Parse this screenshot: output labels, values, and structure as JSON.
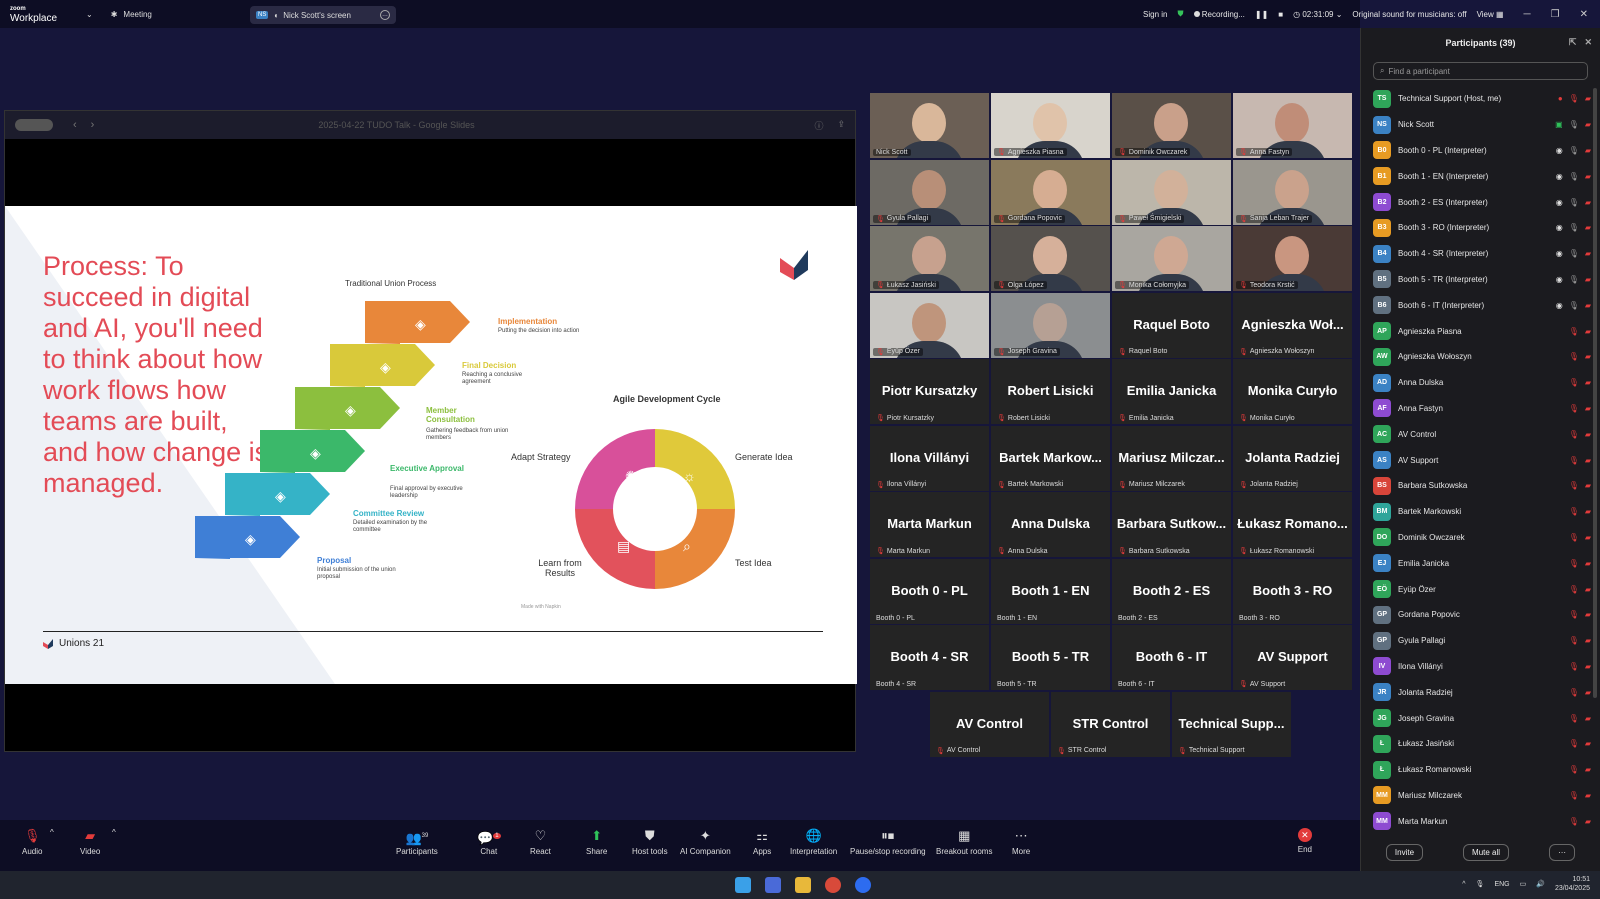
{
  "app": {
    "logo_small": "zoom",
    "logo_name": "Workplace",
    "meeting_label": "Meeting"
  },
  "share_pill": {
    "badge": "NS",
    "label": "Nick Scott's screen"
  },
  "topbar": {
    "sign_in": "Sign in",
    "recording": "Recording...",
    "timer": "02:31:09",
    "original_sound": "Original sound for musicians: off",
    "view": "View"
  },
  "slides_window": {
    "title": "2025-04-22 TUDO Talk - Google Slides"
  },
  "slide": {
    "heading_colon": "Process:",
    "heading_body": "To succeed in digital and AI, you'll need to think about how work flows how teams are built, and how change is managed.",
    "traditional_title": "Traditional Union Process",
    "steps": [
      {
        "label": "Implementation",
        "desc": "Putting the decision into action",
        "color": "#e8873a"
      },
      {
        "label": "Final Decision",
        "desc": "Reaching a conclusive agreement",
        "color": "#d9c93a"
      },
      {
        "label": "Member Consultation",
        "desc": "Gathering feedback from union members",
        "color": "#8cbf3e"
      },
      {
        "label": "Executive Approval",
        "desc": "Final approval by executive leadership",
        "color": "#3bb86a"
      },
      {
        "label": "Committee Review",
        "desc": "Detailed examination by the committee",
        "color": "#35b3c7"
      },
      {
        "label": "Proposal",
        "desc": "Initial submission of the union proposal",
        "color": "#3f7fd6"
      }
    ],
    "agile_title": "Agile Development Cycle",
    "cycle": {
      "adapt": "Adapt Strategy",
      "generate": "Generate Idea",
      "test": "Test Idea",
      "learn": "Learn from Results"
    },
    "made_with": "Made with Napkin",
    "footer": "Unions 21"
  },
  "gallery": {
    "video_tiles": [
      {
        "name": "Nick Scott",
        "active": true,
        "bg": "#6b5f55",
        "skin": "#d9b79a"
      },
      {
        "name": "Agnieszka Piasna",
        "active": false,
        "bg": "#d8d4cc",
        "skin": "#e0c3aa"
      },
      {
        "name": "Dominik Owczarek",
        "active": false,
        "bg": "#5a5048",
        "skin": "#c9a08a"
      },
      {
        "name": "Anna Fastyn",
        "active": false,
        "bg": "#c7b8b0",
        "skin": "#c08d78"
      },
      {
        "name": "Gyula Pallagi",
        "active": false,
        "bg": "#6d6a64",
        "skin": "#b88f78"
      },
      {
        "name": "Gordana Popovic",
        "active": false,
        "bg": "#8a7a5c",
        "skin": "#d6ad92"
      },
      {
        "name": "Paweł Śmigielski",
        "active": false,
        "bg": "#bcb6aa",
        "skin": "#d2b19a"
      },
      {
        "name": "Sanja Leban Trajer",
        "active": false,
        "bg": "#9a968e",
        "skin": "#caa28c"
      },
      {
        "name": "Łukasz Jasiński",
        "active": false,
        "bg": "#77756c",
        "skin": "#c7a18e"
      },
      {
        "name": "Olga López",
        "active": false,
        "bg": "#55514d",
        "skin": "#d6b09a"
      },
      {
        "name": "Monika Cołomyjka",
        "active": false,
        "bg": "#a9a6a0",
        "skin": "#cfa893"
      },
      {
        "name": "Teodora Krstić",
        "active": false,
        "bg": "#4a3a36",
        "skin": "#c99680"
      },
      {
        "name": "Eyüp Özer",
        "active": false,
        "bg": "#c8c6c2",
        "skin": "#bf957c"
      },
      {
        "name": "Joseph Gravina",
        "active": false,
        "bg": "#8b8e90",
        "skin": "#b6a094"
      }
    ],
    "name_tiles": [
      {
        "big": "Raquel Boto",
        "small": "Raquel Boto",
        "muted": true
      },
      {
        "big": "Agnieszka Woł...",
        "small": "Agnieszka Wołoszyn",
        "muted": true
      },
      {
        "big": "Piotr Kursatzky",
        "small": "Piotr Kursatzky",
        "muted": true
      },
      {
        "big": "Robert Lisicki",
        "small": "Robert Lisicki",
        "muted": true
      },
      {
        "big": "Emilia Janicka",
        "small": "Emilia Janicka",
        "muted": true
      },
      {
        "big": "Monika Curyło",
        "small": "Monika Curyło",
        "muted": true
      },
      {
        "big": "Ilona Villányi",
        "small": "Ilona Villányi",
        "muted": true
      },
      {
        "big": "Bartek Markow...",
        "small": "Bartek Markowski",
        "muted": true
      },
      {
        "big": "Mariusz Milczar...",
        "small": "Mariusz Milczarek",
        "muted": true
      },
      {
        "big": "Jolanta Radziej",
        "small": "Jolanta Radziej",
        "muted": true
      },
      {
        "big": "Marta Markun",
        "small": "Marta Markun",
        "muted": true
      },
      {
        "big": "Anna Dulska",
        "small": "Anna Dulska",
        "muted": true
      },
      {
        "big": "Barbara Sutkow...",
        "small": "Barbara Sutkowska",
        "muted": true
      },
      {
        "big": "Łukasz Romano...",
        "small": "Łukasz Romanowski",
        "muted": true
      },
      {
        "big": "Booth 0 - PL",
        "small": "Booth 0 - PL",
        "muted": false
      },
      {
        "big": "Booth 1 - EN",
        "small": "Booth 1 - EN",
        "muted": false
      },
      {
        "big": "Booth 2 - ES",
        "small": "Booth 2 - ES",
        "muted": false
      },
      {
        "big": "Booth 3 - RO",
        "small": "Booth 3 - RO",
        "muted": false
      },
      {
        "big": "Booth 4 - SR",
        "small": "Booth 4 - SR",
        "muted": false
      },
      {
        "big": "Booth 5 - TR",
        "small": "Booth 5 - TR",
        "muted": false
      },
      {
        "big": "Booth 6 - IT",
        "small": "Booth 6 - IT",
        "muted": false
      },
      {
        "big": "AV Support",
        "small": "AV Support",
        "muted": true
      },
      {
        "big": "AV Control",
        "small": "AV Control",
        "muted": true
      },
      {
        "big": "STR Control",
        "small": "STR Control",
        "muted": true
      },
      {
        "big": "Technical Supp...",
        "small": "Technical Support",
        "muted": true
      }
    ]
  },
  "participants": {
    "title": "Participants (39)",
    "search_placeholder": "Find a participant",
    "list": [
      {
        "initials": "TS",
        "name": "Technical Support (Host, me)",
        "color": "#2fa55a"
      },
      {
        "initials": "NS",
        "name": "Nick Scott",
        "color": "#3b82c4"
      },
      {
        "initials": "B0",
        "name": "Booth 0 - PL (Interpreter)",
        "color": "#e79b23"
      },
      {
        "initials": "B1",
        "name": "Booth 1 - EN (Interpreter)",
        "color": "#e79b23"
      },
      {
        "initials": "B2",
        "name": "Booth 2 - ES (Interpreter)",
        "color": "#8e4bd1"
      },
      {
        "initials": "B3",
        "name": "Booth 3 - RO (Interpreter)",
        "color": "#e79b23"
      },
      {
        "initials": "B4",
        "name": "Booth 4 - SR (Interpreter)",
        "color": "#3b82c4"
      },
      {
        "initials": "B5",
        "name": "Booth 5 - TR (Interpreter)",
        "color": "#607080"
      },
      {
        "initials": "B6",
        "name": "Booth 6 - IT (Interpreter)",
        "color": "#607080"
      },
      {
        "initials": "AP",
        "name": "Agnieszka Piasna",
        "color": "#2fa55a"
      },
      {
        "initials": "AW",
        "name": "Agnieszka Wołoszyn",
        "color": "#2fa55a"
      },
      {
        "initials": "AD",
        "name": "Anna Dulska",
        "color": "#3b82c4"
      },
      {
        "initials": "AF",
        "name": "Anna Fastyn",
        "color": "#8e4bd1"
      },
      {
        "initials": "AC",
        "name": "AV Control",
        "color": "#2fa55a"
      },
      {
        "initials": "AS",
        "name": "AV Support",
        "color": "#3b82c4"
      },
      {
        "initials": "BS",
        "name": "Barbara Sutkowska",
        "color": "#d8453a"
      },
      {
        "initials": "BM",
        "name": "Bartek Markowski",
        "color": "#2fa59a"
      },
      {
        "initials": "DO",
        "name": "Dominik Owczarek",
        "color": "#2fa55a"
      },
      {
        "initials": "EJ",
        "name": "Emilia Janicka",
        "color": "#3b82c4"
      },
      {
        "initials": "EÖ",
        "name": "Eyüp Özer",
        "color": "#2fa55a"
      },
      {
        "initials": "GP",
        "name": "Gordana Popovic",
        "color": "#607080"
      },
      {
        "initials": "GP",
        "name": "Gyula Pallagi",
        "color": "#607080"
      },
      {
        "initials": "IV",
        "name": "Ilona Villányi",
        "color": "#8e4bd1"
      },
      {
        "initials": "JR",
        "name": "Jolanta Radziej",
        "color": "#3b82c4"
      },
      {
        "initials": "JG",
        "name": "Joseph Gravina",
        "color": "#2fa55a"
      },
      {
        "initials": "Ł",
        "name": "Łukasz Jasiński",
        "color": "#2fa55a"
      },
      {
        "initials": "Ł",
        "name": "Łukasz Romanowski",
        "color": "#2fa55a"
      },
      {
        "initials": "MM",
        "name": "Mariusz Milczarek",
        "color": "#e79b23"
      },
      {
        "initials": "MM",
        "name": "Marta Markun",
        "color": "#8e4bd1"
      }
    ],
    "invite": "Invite",
    "mute_all": "Mute all",
    "more": "···"
  },
  "toolbar": {
    "audio": "Audio",
    "video": "Video",
    "participants": "Participants",
    "participants_count": "39",
    "chat": "Chat",
    "chat_badge": "1",
    "react": "React",
    "share": "Share",
    "host_tools": "Host tools",
    "ai_companion": "AI Companion",
    "apps": "Apps",
    "interpretation": "Interpretation",
    "pause_recording": "Pause/stop recording",
    "breakout": "Breakout rooms",
    "more": "More",
    "end": "End"
  },
  "taskbar": {
    "lang": "ENG",
    "time": "10:51",
    "date": "23/04/2025"
  }
}
